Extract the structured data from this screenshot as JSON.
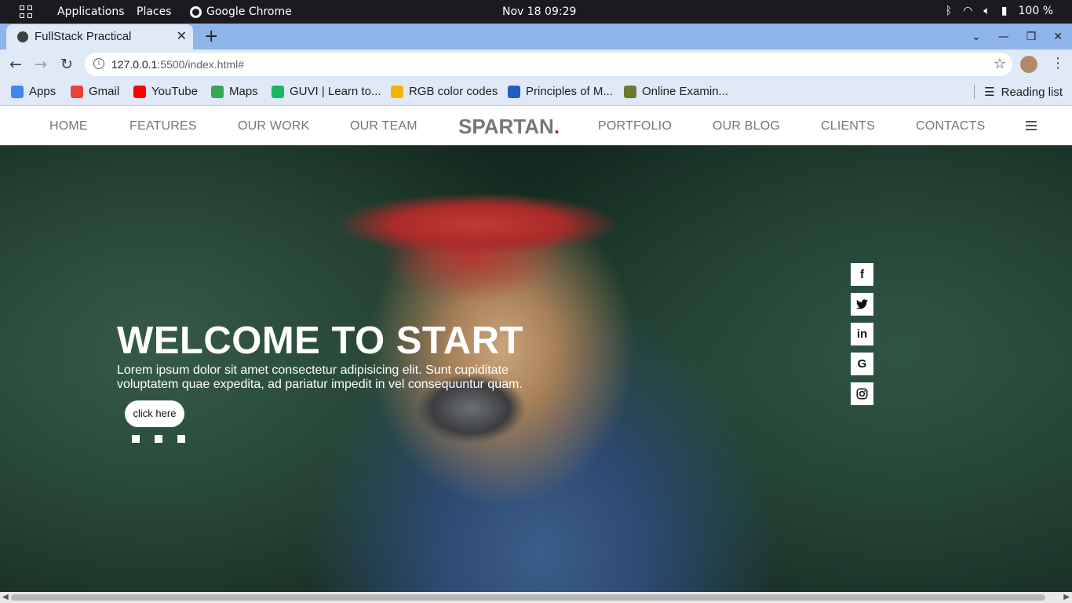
{
  "system": {
    "applications": "Applications",
    "places": "Places",
    "app": "Google Chrome",
    "clock": "Nov 18  09:29",
    "battery": "100 %"
  },
  "browser": {
    "tab_title": "FullStack Practical",
    "url_host": "127.0.0.1",
    "url_path": ":5500/index.html#",
    "bookmarks": [
      {
        "label": "Apps",
        "color": "#4285f4"
      },
      {
        "label": "Gmail",
        "color": "#ea4335"
      },
      {
        "label": "YouTube",
        "color": "#ff0000"
      },
      {
        "label": "Maps",
        "color": "#34a853"
      },
      {
        "label": "GUVI | Learn to...",
        "color": "#1ab765"
      },
      {
        "label": "RGB color codes",
        "color": "#f4b400"
      },
      {
        "label": "Principles of M...",
        "color": "#1f5fbf"
      },
      {
        "label": "Online Examin...",
        "color": "#6b7a2a"
      }
    ],
    "reading_list": "Reading list"
  },
  "site": {
    "nav": [
      "HOME",
      "FEATURES",
      "OUR WORK",
      "OUR TEAM",
      "PORTFOLIO",
      "OUR BLOG",
      "CLIENTS",
      "CONTACTS"
    ],
    "brand": "SPARTAN",
    "brand_dot": ".",
    "hero_title": "WELCOME TO START",
    "hero_subtitle": "Lorem ipsum dolor sit amet consectetur adipisicing elit. Sunt cupiditate voluptatem quae expedita, ad pariatur impedit in vel consequuntur quam.",
    "hero_button": "click here",
    "social": [
      {
        "icon": "facebook-icon",
        "glyph": "f"
      },
      {
        "icon": "twitter-icon",
        "glyph": "t"
      },
      {
        "icon": "linkedin-icon",
        "glyph": "in"
      },
      {
        "icon": "google-icon",
        "glyph": "G"
      },
      {
        "icon": "instagram-icon",
        "glyph": "◎"
      }
    ],
    "accent_color": "#e51b23"
  }
}
